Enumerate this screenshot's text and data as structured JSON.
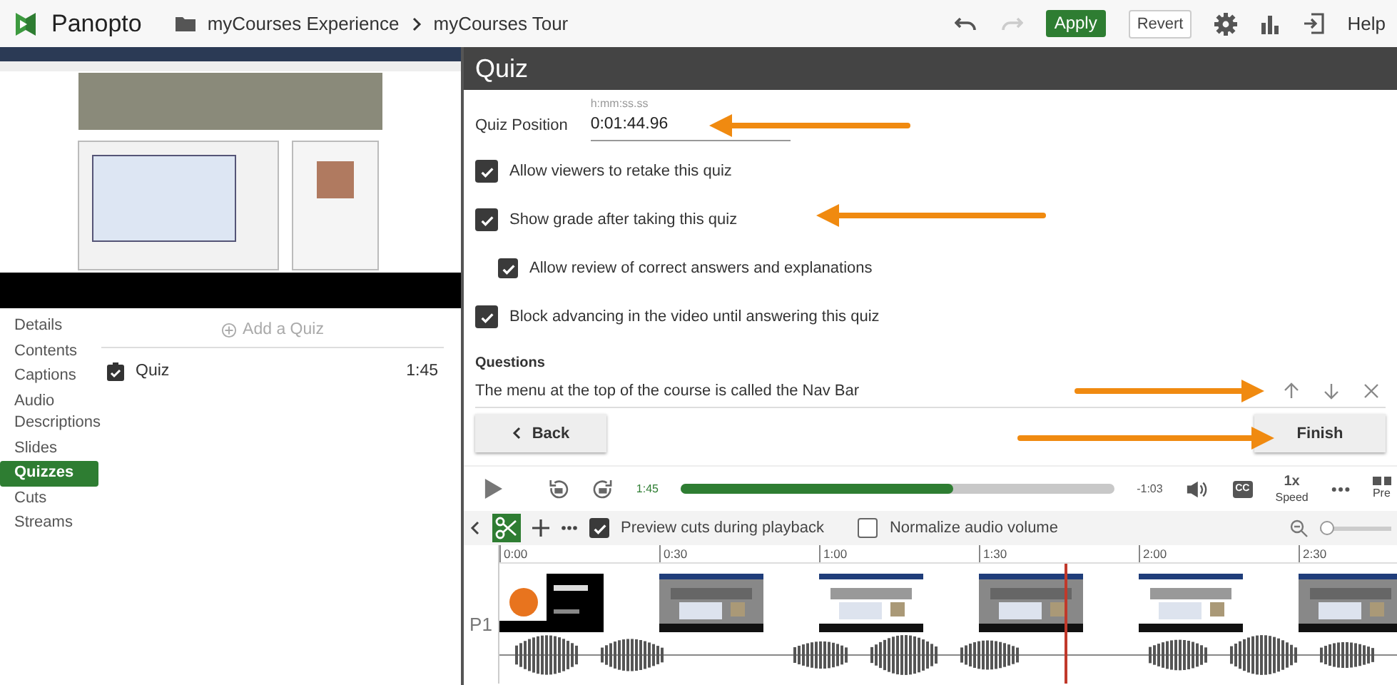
{
  "header": {
    "logo": "Panopto",
    "breadcrumb": [
      "myCourses Experience",
      "myCourses Tour"
    ],
    "apply": "Apply",
    "revert": "Revert",
    "help": "Help"
  },
  "sidebar": {
    "items": [
      {
        "label": "Details",
        "selected": false
      },
      {
        "label": "Contents",
        "selected": false
      },
      {
        "label": "Captions",
        "selected": false
      },
      {
        "label": "Audio Descriptions",
        "selected": false
      },
      {
        "label": "Slides",
        "selected": false
      },
      {
        "label": "Quizzes",
        "selected": true
      },
      {
        "label": "Cuts",
        "selected": false
      },
      {
        "label": "Streams",
        "selected": false
      }
    ]
  },
  "quiz_list": {
    "add": "Add a Quiz",
    "items": [
      {
        "title": "Quiz",
        "time": "1:45"
      }
    ]
  },
  "quiz_panel": {
    "title": "Quiz",
    "position_label": "Quiz Position",
    "position_hint": "h:mm:ss.ss",
    "position_value": "0:01:44.96",
    "options": [
      {
        "label": "Allow viewers to retake this quiz",
        "checked": true
      },
      {
        "label": "Show grade after taking this quiz",
        "checked": true,
        "children": [
          {
            "label": "Allow review of correct answers and explanations",
            "checked": true
          }
        ]
      },
      {
        "label": "Block advancing in the video until answering this quiz",
        "checked": true
      }
    ],
    "questions_heading": "Questions",
    "questions": [
      "The menu at the top of the course is called the Nav Bar"
    ],
    "back": "Back",
    "finish": "Finish"
  },
  "player": {
    "elapsed": "1:45",
    "remaining": "-1:03",
    "level": 0.63,
    "cc": "CC",
    "speed": "1x",
    "speed_label": "Speed",
    "cut_off_label": "Pre"
  },
  "timeline": {
    "preview_cuts": {
      "label": "Preview cuts during playback",
      "checked": true
    },
    "normalize": {
      "label": "Normalize audio volume",
      "checked": false
    },
    "zoom": {
      "level": 0
    },
    "ticks": [
      "0:00",
      "0:30",
      "1:00",
      "1:30",
      "2:00",
      "2:30"
    ],
    "track_label": "P1"
  }
}
